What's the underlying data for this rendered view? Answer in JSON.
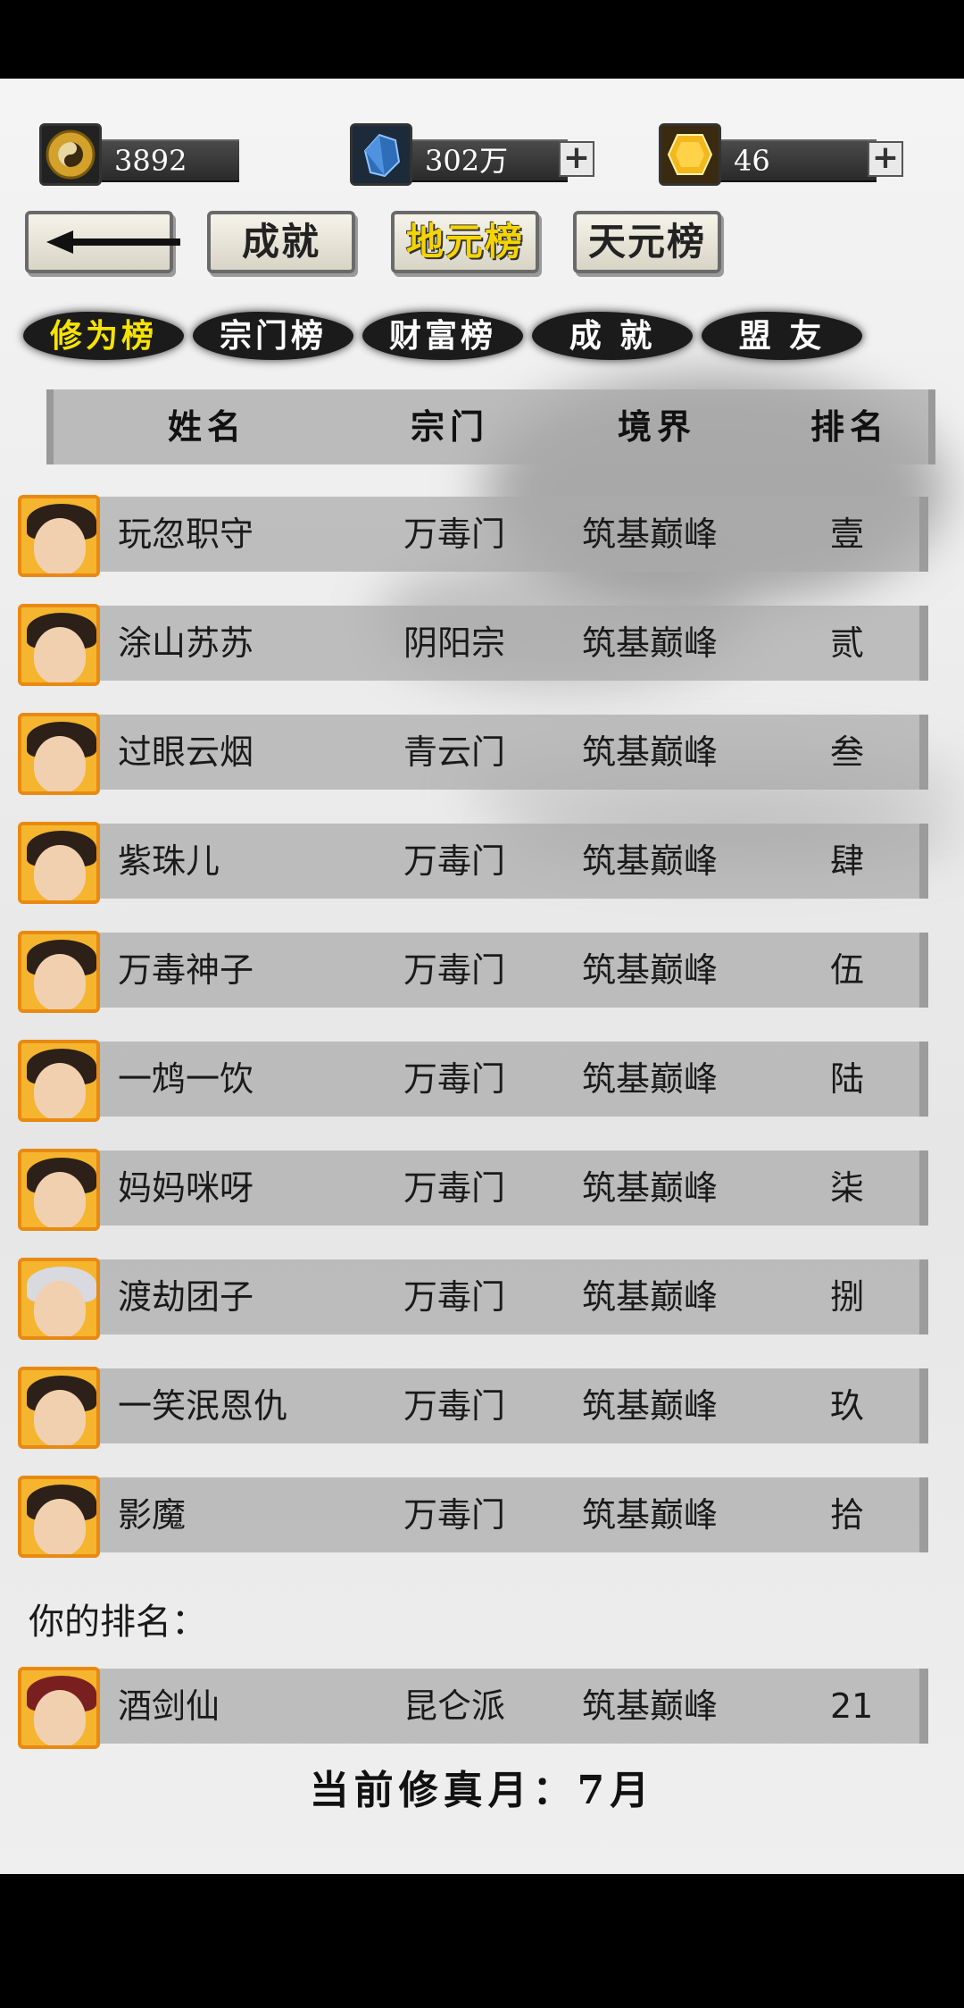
{
  "currency": {
    "coin": {
      "icon": "taiji-coin-icon",
      "value": "3892"
    },
    "crystal": {
      "icon": "blue-crystal-icon",
      "value": "302万"
    },
    "gem": {
      "icon": "gold-gem-icon",
      "value": "46"
    }
  },
  "nav": {
    "back_icon": "arrow-left-icon",
    "achievements": "成就",
    "earth_ranking": "地元榜",
    "heaven_ranking": "天元榜",
    "active": "地元榜"
  },
  "tabs": [
    {
      "label": "修为榜",
      "active": true
    },
    {
      "label": "宗门榜",
      "active": false
    },
    {
      "label": "财富榜",
      "active": false
    },
    {
      "label": "成 就",
      "active": false
    },
    {
      "label": "盟 友",
      "active": false
    }
  ],
  "table": {
    "headers": [
      "姓名",
      "宗门",
      "境界",
      "排名"
    ],
    "rows": [
      {
        "name": "玩忽职守",
        "sect": "万毒门",
        "realm": "筑基巅峰",
        "rank": "壹"
      },
      {
        "name": "涂山苏苏",
        "sect": "阴阳宗",
        "realm": "筑基巅峰",
        "rank": "贰"
      },
      {
        "name": "过眼云烟",
        "sect": "青云门",
        "realm": "筑基巅峰",
        "rank": "叁"
      },
      {
        "name": "紫珠儿",
        "sect": "万毒门",
        "realm": "筑基巅峰",
        "rank": "肆"
      },
      {
        "name": "万毒神子",
        "sect": "万毒门",
        "realm": "筑基巅峰",
        "rank": "伍"
      },
      {
        "name": "一鸩一饮",
        "sect": "万毒门",
        "realm": "筑基巅峰",
        "rank": "陆"
      },
      {
        "name": "妈妈咪呀",
        "sect": "万毒门",
        "realm": "筑基巅峰",
        "rank": "柒"
      },
      {
        "name": "渡劫团子",
        "sect": "万毒门",
        "realm": "筑基巅峰",
        "rank": "捌"
      },
      {
        "name": "一笑泯恩仇",
        "sect": "万毒门",
        "realm": "筑基巅峰",
        "rank": "玖"
      },
      {
        "name": "影魔",
        "sect": "万毒门",
        "realm": "筑基巅峰",
        "rank": "拾"
      }
    ]
  },
  "you": {
    "label": "你的排名：",
    "name": "酒剑仙",
    "sect": "昆仑派",
    "realm": "筑基巅峰",
    "rank": "21"
  },
  "footer": {
    "current_month": "当前修真月：7月"
  },
  "colors": {
    "accent_yellow": "#f7e300",
    "avatar_frame": "#e88a12"
  }
}
